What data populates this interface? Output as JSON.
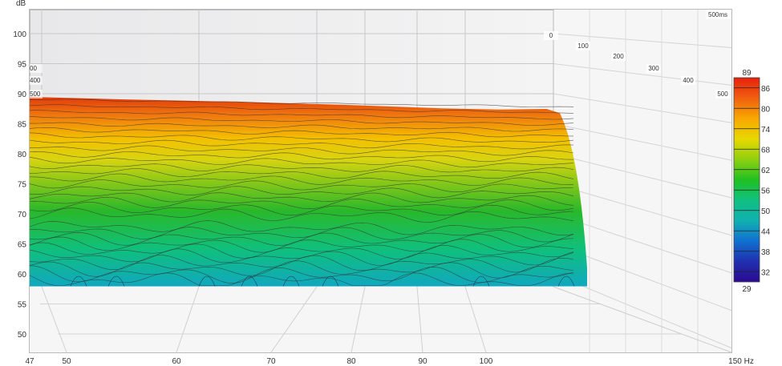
{
  "chart_data": {
    "type": "waterfall",
    "title": "",
    "ylabel": "dB",
    "xlabel": "Hz",
    "ylim": [
      47,
      103
    ],
    "xlim": [
      47,
      150
    ],
    "y_ticks": [
      100,
      95,
      90,
      85,
      80,
      75,
      70,
      65,
      60,
      55,
      50
    ],
    "x_ticks": [
      {
        "v": 47,
        "l": "47"
      },
      {
        "v": 50,
        "l": "50"
      },
      {
        "v": 60,
        "l": "60"
      },
      {
        "v": 70,
        "l": "70"
      },
      {
        "v": 80,
        "l": "80"
      },
      {
        "v": 90,
        "l": "90"
      },
      {
        "v": 100,
        "l": "100"
      },
      {
        "v": 150,
        "l": "150 Hz"
      }
    ],
    "time_axis": {
      "unit": "ms",
      "ticks": [
        "0",
        "100",
        "200",
        "300",
        "400",
        "500"
      ],
      "max_label": "500ms",
      "left_edge_labels": [
        "00",
        "400",
        "500"
      ]
    },
    "surface": {
      "freq": [
        47,
        55,
        65,
        75,
        85,
        95,
        105,
        112,
        113
      ],
      "top_db": [
        89.2,
        88.8,
        88.3,
        87.9,
        87.6,
        87.3,
        87.1,
        87.2,
        86.5
      ],
      "floor_db": 58.0,
      "freq_end": 113
    },
    "contour_levels": [
      88,
      87,
      86,
      85,
      84,
      83,
      82,
      81,
      80,
      79,
      78,
      77,
      76,
      75,
      74,
      73,
      72,
      71,
      70,
      69,
      68,
      67,
      66,
      65,
      64,
      63,
      62,
      61,
      60,
      59
    ],
    "colorbar": {
      "max": "89",
      "min": "29",
      "ticks": [
        "86",
        "80",
        "74",
        "68",
        "62",
        "56",
        "50",
        "44",
        "38",
        "32"
      ],
      "colors": [
        "#e8200c",
        "#f06010",
        "#f8a800",
        "#e8d800",
        "#90d010",
        "#20c020",
        "#10c080",
        "#10b0b0",
        "#1070d0",
        "#2030b0",
        "#2a0a90"
      ]
    },
    "grid": true
  }
}
